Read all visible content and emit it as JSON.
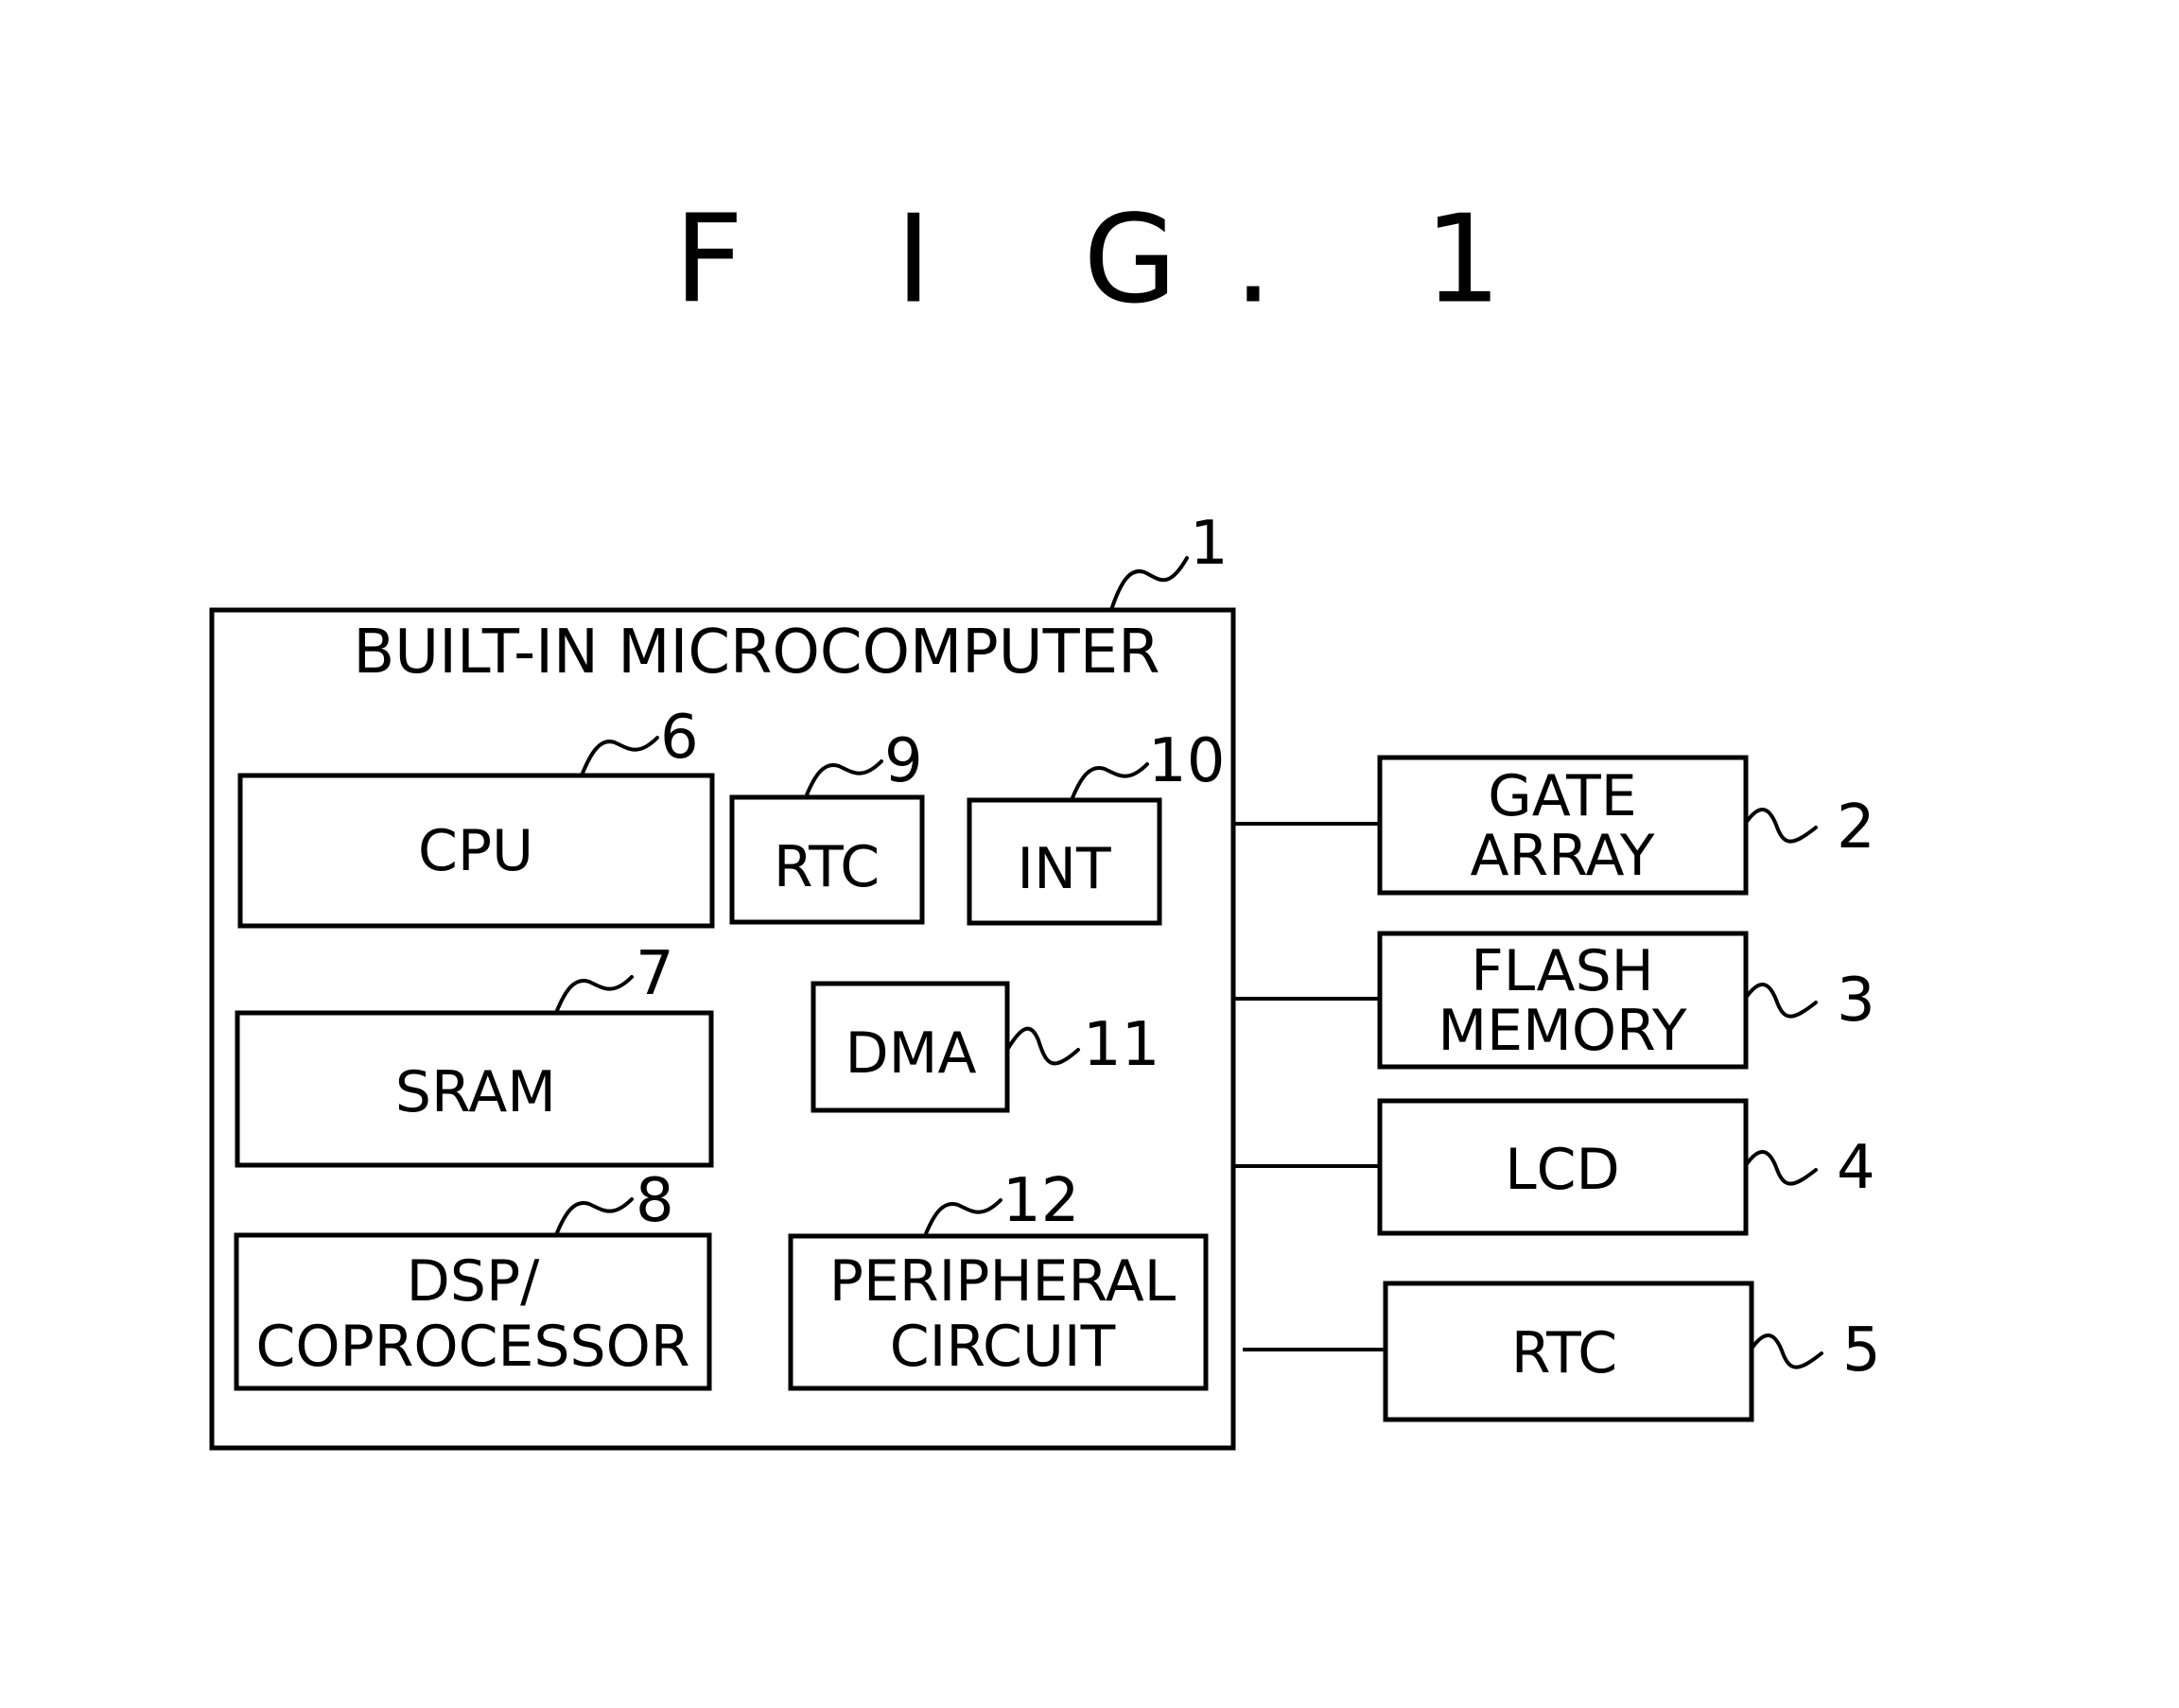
{
  "figure": {
    "title": "F I G. 1"
  },
  "microcomputer": {
    "label": "BUILT-IN MICROCOMPUTER",
    "ref": "1",
    "blocks": {
      "cpu": {
        "label": "CPU",
        "ref": "6"
      },
      "sram": {
        "label": "SRAM",
        "ref": "7"
      },
      "dsp": {
        "line1": "DSP/",
        "line2": "COPROCESSOR",
        "ref": "8"
      },
      "rtc": {
        "label": "RTC",
        "ref": "9"
      },
      "int": {
        "label": "INT",
        "ref": "10"
      },
      "dma": {
        "label": "DMA",
        "ref": "11"
      },
      "peripheral": {
        "line1": "PERIPHERAL",
        "line2": "CIRCUIT",
        "ref": "12"
      }
    }
  },
  "external": {
    "gate_array": {
      "line1": "GATE",
      "line2": "ARRAY",
      "ref": "2"
    },
    "flash": {
      "line1": "FLASH",
      "line2": "MEMORY",
      "ref": "3"
    },
    "lcd": {
      "label": "LCD",
      "ref": "4"
    },
    "rtc": {
      "label": "RTC",
      "ref": "5"
    }
  }
}
